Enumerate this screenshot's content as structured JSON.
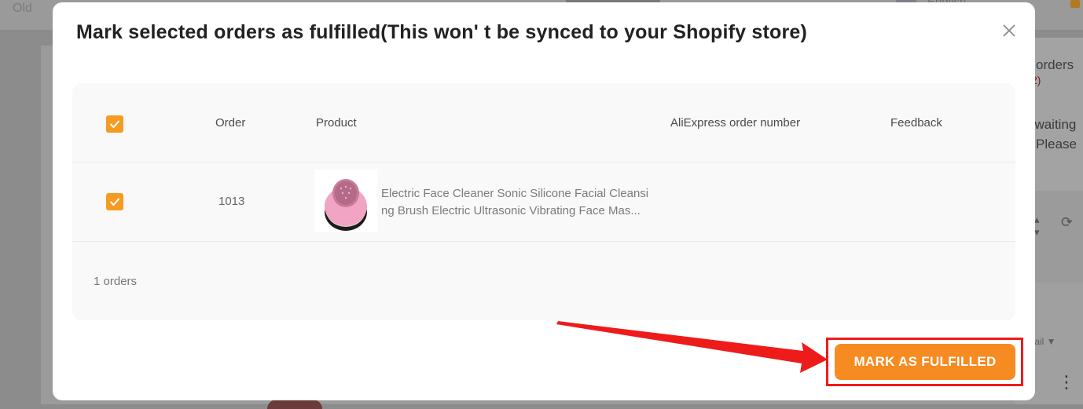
{
  "background": {
    "top_left_text": "Old",
    "language": "English",
    "panel_title": "orders",
    "panel_count": "2)",
    "notice_line1": "awaiting",
    "notice_line2": "Please",
    "detail_label": "tail"
  },
  "modal": {
    "title": "Mark selected orders as fulfilled(This won' t be synced to your Shopify store)",
    "close_icon": "close-icon",
    "table": {
      "columns": [
        "Order",
        "Product",
        "AliExpress order number",
        "Feedback"
      ],
      "rows": [
        {
          "checked": true,
          "order": "1013",
          "product": "Electric Face Cleaner Sonic Silicone Facial Cleansing Brush Electric Ultrasonic Vibrating Face Mas...",
          "aliexpress_order_number": "",
          "feedback": ""
        }
      ],
      "select_all_checked": true,
      "footer_count": "1 orders"
    },
    "primary_button": "MARK AS FULFILLED"
  },
  "colors": {
    "accent": "#f68b22",
    "checkbox": "#f59a23",
    "annotation": "#ee1b1b"
  }
}
